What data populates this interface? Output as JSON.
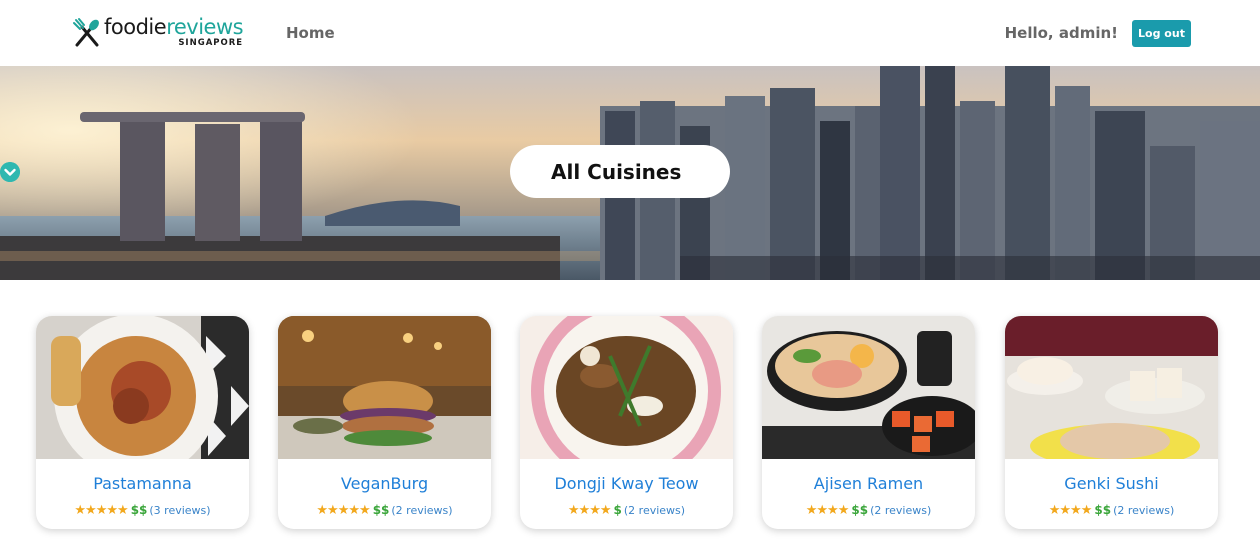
{
  "header": {
    "logo_main_a": "foodie",
    "logo_main_b": "reviews",
    "logo_sub": "SINGAPORE",
    "nav_home": "Home",
    "greeting": "Hello, admin!",
    "logout_label": "Log out"
  },
  "hero": {
    "cuisine_selected": "All Cuisines"
  },
  "cards": [
    {
      "name": "Pastamanna",
      "stars": "★★★★★",
      "price": "$$",
      "reviews": "(3 reviews)"
    },
    {
      "name": "VeganBurg",
      "stars": "★★★★★",
      "price": "$$",
      "reviews": "(2 reviews)"
    },
    {
      "name": "Dongji Kway Teow",
      "stars": "★★★★",
      "price": "$",
      "reviews": "(2 reviews)"
    },
    {
      "name": "Ajisen Ramen",
      "stars": "★★★★",
      "price": "$$",
      "reviews": "(2 reviews)"
    },
    {
      "name": "Genki Sushi",
      "stars": "★★★★",
      "price": "$$",
      "reviews": "(2 reviews)"
    }
  ],
  "colors": {
    "brand_teal": "#1fa59b",
    "button": "#1a9bac",
    "link_blue": "#1f7fd8",
    "star": "#f2a81d",
    "price_green": "#3aa53a"
  }
}
